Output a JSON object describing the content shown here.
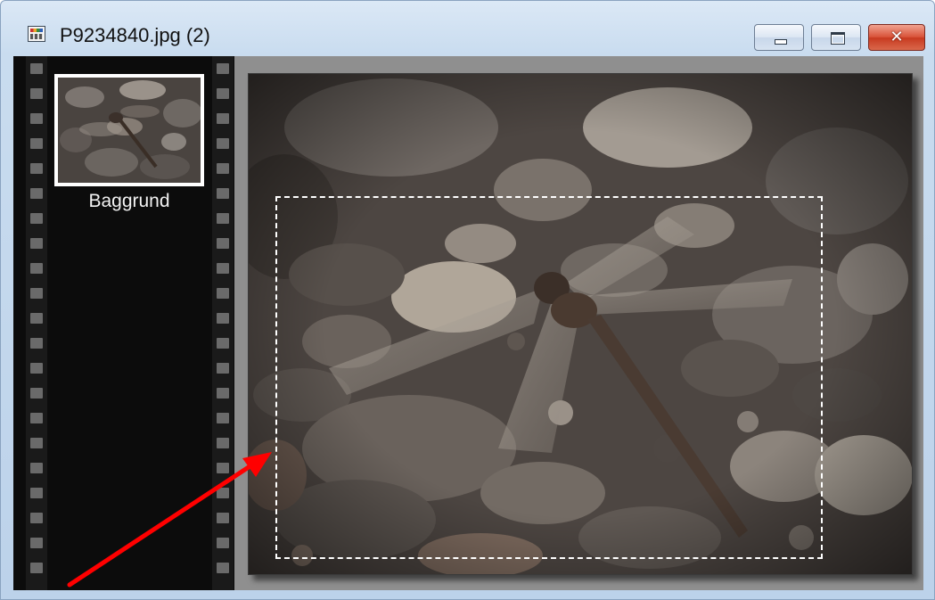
{
  "window": {
    "title": "P9234840.jpg (2)",
    "icon": "image-document-icon",
    "buttons": {
      "minimize": "minimize-icon",
      "maximize": "maximize-icon",
      "close": "close-icon"
    },
    "close_glyph": "✕"
  },
  "layers_panel": {
    "layers": [
      {
        "label": "Baggrund"
      }
    ]
  },
  "colors": {
    "titlebar": "#c9dcef",
    "close_button": "#c83a20",
    "filmstrip": "#0c0c0c",
    "workspace": "#8f8f8f",
    "selection_marquee": "#ffffff",
    "annotation_arrow": "#ff0000"
  }
}
